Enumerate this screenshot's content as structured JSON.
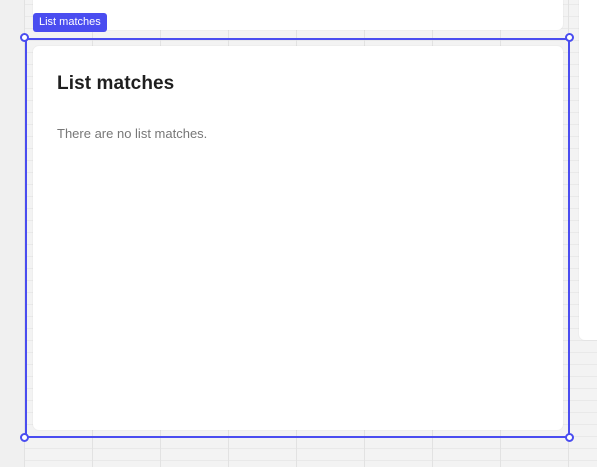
{
  "selection": {
    "label": "List matches",
    "accent_color": "#4a4df0"
  },
  "list_matches": {
    "title": "List matches",
    "empty_message": "There are no list matches."
  }
}
